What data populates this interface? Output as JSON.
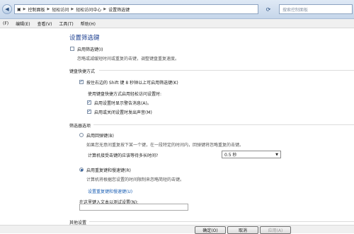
{
  "address_bar": {
    "crumbs": [
      "控制面板",
      "轻松访问",
      "轻松访问中心",
      "设置筛选键"
    ],
    "search_placeholder": "搜索控制面板"
  },
  "menu": [
    "(F)",
    "编辑(E)",
    "查看(V)",
    "工具(T)",
    "帮助(H)"
  ],
  "page": {
    "title": "设置筛选键",
    "enable_filter_keys": "启用筛选键(I)",
    "enable_desc": "忽略或减缓短时间或重复的击键，调整键盘重复速度。",
    "shortcut_section": "键盘快捷方式",
    "shortcut_option": "按住右边的 Shift 键 8 秒钟以上可启用筛选键(K)",
    "shortcut_sub": "使用键盘快捷方式启用轻松访问设置时:",
    "warn_option": "启用设置时显示警告消息(A)。",
    "sound_option": "启用或关闭设置时发出声音(M)",
    "filter_section": "筛选器选项",
    "bounce_keys": "启用回弹键(B)",
    "bounce_desc": "如果您无意间重复按下某一个键，在一段特定的时间内，回弹键将忽略重复的击键。",
    "wait_question": "计算机接受击键的应该等待多长时间?",
    "wait_value": "0.5 秒",
    "repeat_keys": "启用重复键和慢速键(R)",
    "repeat_desc": "计算机将根据您设置的时间限制来忽略简短的击键。",
    "repeat_link": "设置重复键和慢速键(U)",
    "test_label": "在这里键入文本以测试设置(N):",
    "other_section": "其他设置"
  },
  "buttons": {
    "ok": "确定(O)",
    "cancel": "取消",
    "apply": "应用(A)"
  }
}
